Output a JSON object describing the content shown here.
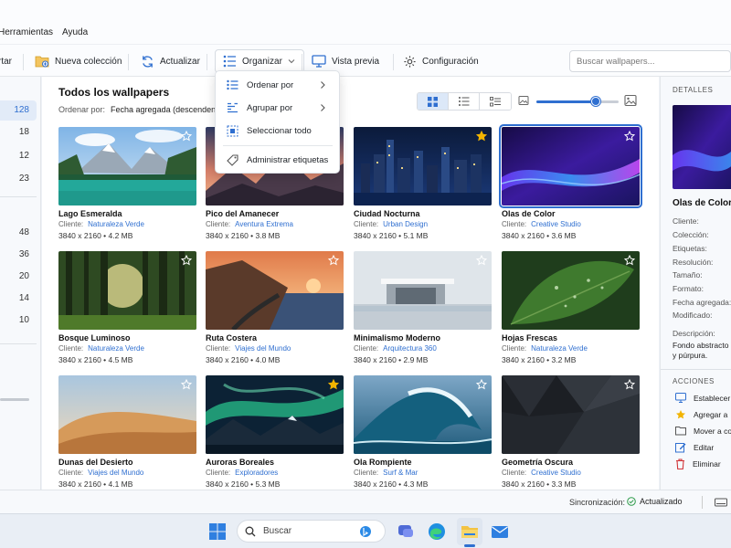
{
  "menu": {
    "items": [
      "Herramientas",
      "Ayuda"
    ]
  },
  "toolbar": {
    "partial_label": "rtar",
    "new_collection": "Nueva colección",
    "refresh": "Actualizar",
    "organize": "Organizar",
    "preview": "Vista previa",
    "settings": "Configuración",
    "search_placeholder": "Buscar wallpapers..."
  },
  "sidebar": {
    "counts": [
      "128",
      "18",
      "12",
      "23",
      "48",
      "36",
      "20",
      "14",
      "10"
    ],
    "selected_index": 0
  },
  "main": {
    "title": "Todos los wallpapers",
    "sort_label": "Ordenar por:",
    "sort_value": "Fecha agregada  (descenden",
    "zoom_fraction": 0.72
  },
  "dropdown": {
    "items": [
      "Ordenar por",
      "Agrupar por",
      "Seleccionar todo",
      "Administrar etiquetas"
    ]
  },
  "wallpapers": [
    {
      "name": "Lago Esmeralda",
      "client_label": "Cliente:",
      "client": "Naturaleza Verde",
      "meta": "3840 x 2160  •  4.2 MB",
      "favorite": false
    },
    {
      "name": "Pico del Amanecer",
      "client_label": "Cliente:",
      "client": "Aventura Extrema",
      "meta": "3840 x 2160  •  3.8 MB",
      "favorite": false
    },
    {
      "name": "Ciudad Nocturna",
      "client_label": "Cliente:",
      "client": "Urban Design",
      "meta": "3840 x 2160  •  5.1 MB",
      "favorite": true
    },
    {
      "name": "Olas de Color",
      "client_label": "Cliente:",
      "client": "Creative Studio",
      "meta": "3840 x 2160  •  3.6 MB",
      "favorite": false
    },
    {
      "name": "Bosque Luminoso",
      "client_label": "Cliente:",
      "client": "Naturaleza Verde",
      "meta": "3840 x 2160  •  4.5 MB",
      "favorite": false
    },
    {
      "name": "Ruta Costera",
      "client_label": "Cliente:",
      "client": "Viajes del Mundo",
      "meta": "3840 x 2160  •  4.0 MB",
      "favorite": false
    },
    {
      "name": "Minimalismo Moderno",
      "client_label": "Cliente:",
      "client": "Arquitectura 360",
      "meta": "3840 x 2160  •  2.9 MB",
      "favorite": false
    },
    {
      "name": "Hojas Frescas",
      "client_label": "Cliente:",
      "client": "Naturaleza Verde",
      "meta": "3840 x 2160  •  3.2 MB",
      "favorite": false
    },
    {
      "name": "Dunas del Desierto",
      "client_label": "Cliente:",
      "client": "Viajes del Mundo",
      "meta": "3840 x 2160  •  4.1 MB",
      "favorite": false
    },
    {
      "name": "Auroras Boreales",
      "client_label": "Cliente:",
      "client": "Exploradores",
      "meta": "3840 x 2160  •  5.3 MB",
      "favorite": true
    },
    {
      "name": "Ola Rompiente",
      "client_label": "Cliente:",
      "client": "Surf & Mar",
      "meta": "3840 x 2160  •  4.3 MB",
      "favorite": false
    },
    {
      "name": "Geometría Oscura",
      "client_label": "Cliente:",
      "client": "Creative Studio",
      "meta": "3840 x 2160  •  3.3 MB",
      "favorite": false
    }
  ],
  "details": {
    "header": "DETALLES",
    "title": "Olas de Color",
    "labels": [
      "Cliente:",
      "Colección:",
      "Etiquetas:",
      "Resolución:",
      "Tamaño:",
      "Formato:",
      "Fecha agregada:",
      "Modificado:",
      "Descripción:"
    ],
    "description": "Fondo abstracto azul y púrpura.",
    "actions_header": "ACCIONES",
    "actions": [
      "Establecer",
      "Agregar a",
      "Mover a co",
      "Editar",
      "Eliminar"
    ]
  },
  "status": {
    "sync_label": "Sincronización:",
    "sync_value": "Actualizado"
  },
  "taskbar": {
    "search": "Buscar"
  },
  "colors": {
    "accent": "#2f6fd0",
    "star": "#f2b400",
    "danger": "#d13438"
  }
}
